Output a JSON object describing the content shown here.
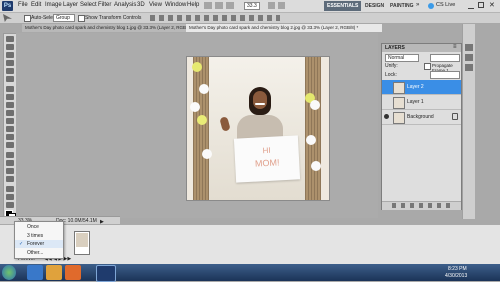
{
  "colors": {
    "accent_blue": "#3a8ee6",
    "menubar": "#dcdcdc",
    "canvas": "#ababab",
    "taskbar": "#1b3357"
  },
  "menubar": {
    "logo": "Ps",
    "items": [
      "File",
      "Edit",
      "Image",
      "Layer",
      "Select",
      "Filter",
      "Analysis",
      "3D",
      "View",
      "Window",
      "Help"
    ],
    "zoom": "33.3",
    "workspaces": [
      "ESSENTIALS",
      "DESIGN",
      "PAINTING"
    ],
    "more": "»",
    "cs_live": "CS Live"
  },
  "optionsbar": {
    "auto_select_label": "Auto-Select:",
    "auto_select_value": "Group",
    "transform_label": "Show Transform Controls"
  },
  "tabs": [
    {
      "label": "Mother's Day photo card spark and chemistry blog 1.jpg @ 33.3% (Layer 2, RGB/8) *"
    },
    {
      "label": "Mother's Day photo card spark and chemistry blog 2.jpg @ 33.3% (Layer 2, RGB/8) *"
    }
  ],
  "document": {
    "sign_line1": "HI",
    "sign_line2": "MOM!"
  },
  "statusbar": {
    "zoom": "33.3%",
    "doc": "Doc: 10.0M/54.1M"
  },
  "loop_menu": {
    "options": [
      "Once",
      "3 times",
      "Forever",
      "Other..."
    ],
    "selected_index": 2,
    "check": "✓"
  },
  "animation": {
    "loop_value": "Forever"
  },
  "layers_panel": {
    "title": "LAYERS",
    "blend_mode": "Normal",
    "unify_label": "Unify:",
    "propagate_label": "Propagate Frame 1",
    "lock_label": "Lock:",
    "layers": [
      {
        "name": "Layer 2",
        "selected": true,
        "visible": false
      },
      {
        "name": "Layer 1",
        "selected": false,
        "visible": false
      },
      {
        "name": "Background",
        "selected": false,
        "visible": true
      }
    ]
  },
  "taskbar": {
    "time": "8:23 PM",
    "date": "4/30/2013"
  }
}
